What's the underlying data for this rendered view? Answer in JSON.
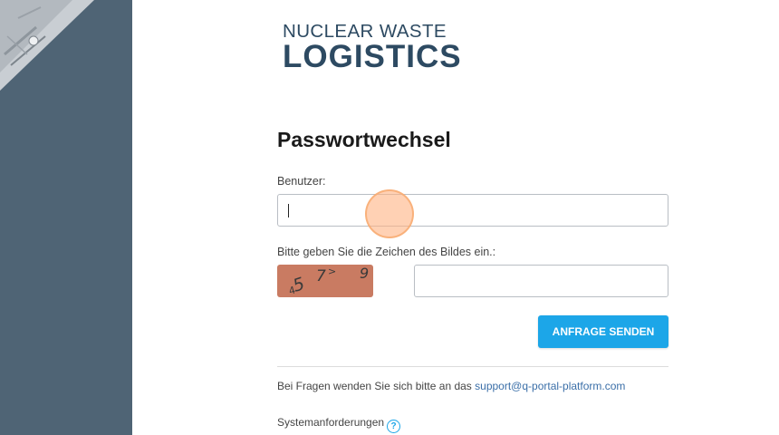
{
  "logo": {
    "line1": "NUCLEAR WASTE",
    "line2": "LOGISTICS"
  },
  "form": {
    "title": "Passwortwechsel",
    "user_label": "Benutzer:",
    "user_value": "",
    "captcha_label": "Bitte geben Sie die Zeichen des Bildes ein.:",
    "captcha_chars": [
      "4",
      "5",
      "7",
      ">",
      "9"
    ],
    "captcha_value": "",
    "submit_label": "ANFRAGE SENDEN"
  },
  "footer": {
    "help_text": "Bei Fragen wenden Sie sich bitte an das ",
    "help_email": "support@q-portal-platform.com",
    "system_requirements": "Systemanforderungen",
    "help_icon_glyph": "?"
  },
  "colors": {
    "side_panel": "#4f6475",
    "brand_text": "#2d4a62",
    "button": "#1ca6e8",
    "link": "#3b6fa8",
    "captcha_bg": "#c97b62"
  }
}
